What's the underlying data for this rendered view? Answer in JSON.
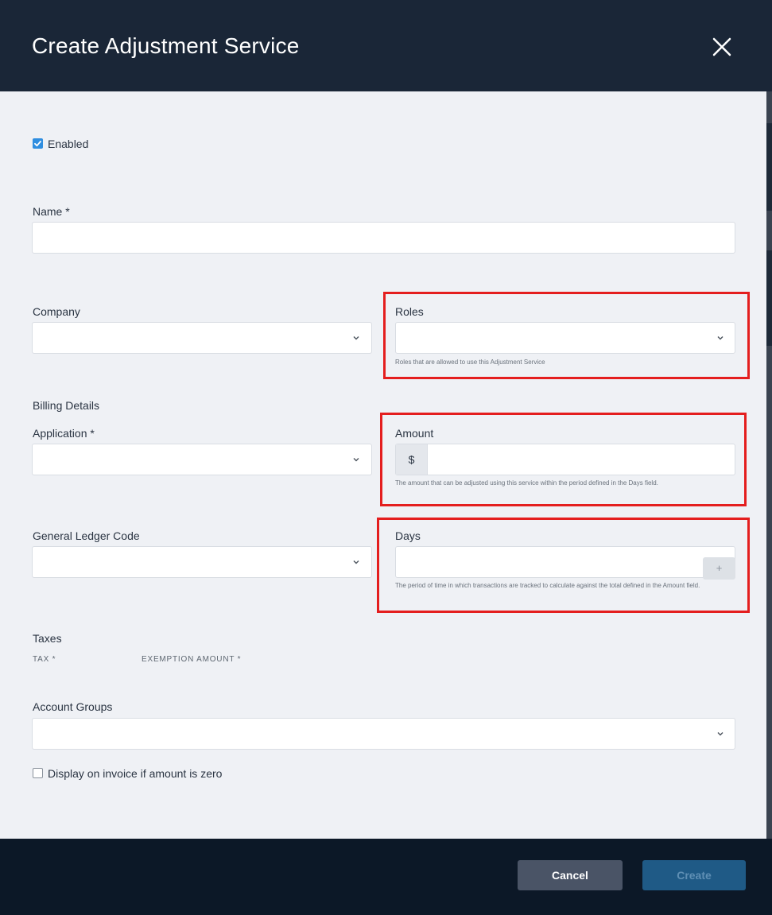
{
  "modal": {
    "title": "Create Adjustment Service",
    "close_icon": "close-icon"
  },
  "enabled": {
    "label": "Enabled",
    "checked": true
  },
  "name": {
    "label": "Name *",
    "value": ""
  },
  "company": {
    "label": "Company",
    "value": ""
  },
  "roles": {
    "label": "Roles",
    "value": "",
    "help": "Roles that are allowed to use this Adjustment Service"
  },
  "billing": {
    "section_title": "Billing Details"
  },
  "application": {
    "label": "Application *",
    "value": ""
  },
  "amount": {
    "label": "Amount",
    "prefix": "$",
    "value": "",
    "help": "The amount that can be adjusted using this service within the period defined in the Days field."
  },
  "gl_code": {
    "label": "General Ledger Code",
    "value": ""
  },
  "days": {
    "label": "Days",
    "value": "",
    "help": "The period of time in which transactions are tracked to calculate against the total defined in the Amount field."
  },
  "taxes": {
    "section_title": "Taxes",
    "col_tax": "TAX *",
    "col_exemption": "EXEMPTION AMOUNT *",
    "add_label": "+"
  },
  "account_groups": {
    "label": "Account Groups",
    "value": ""
  },
  "display_zero": {
    "label": "Display on invoice if amount is zero",
    "checked": false
  },
  "footer": {
    "cancel_label": "Cancel",
    "create_label": "Create"
  },
  "colors": {
    "header_bg": "#1a2637",
    "footer_bg": "#0c1827",
    "highlight": "#e41e1e",
    "checkbox_on": "#2f8ee0"
  }
}
